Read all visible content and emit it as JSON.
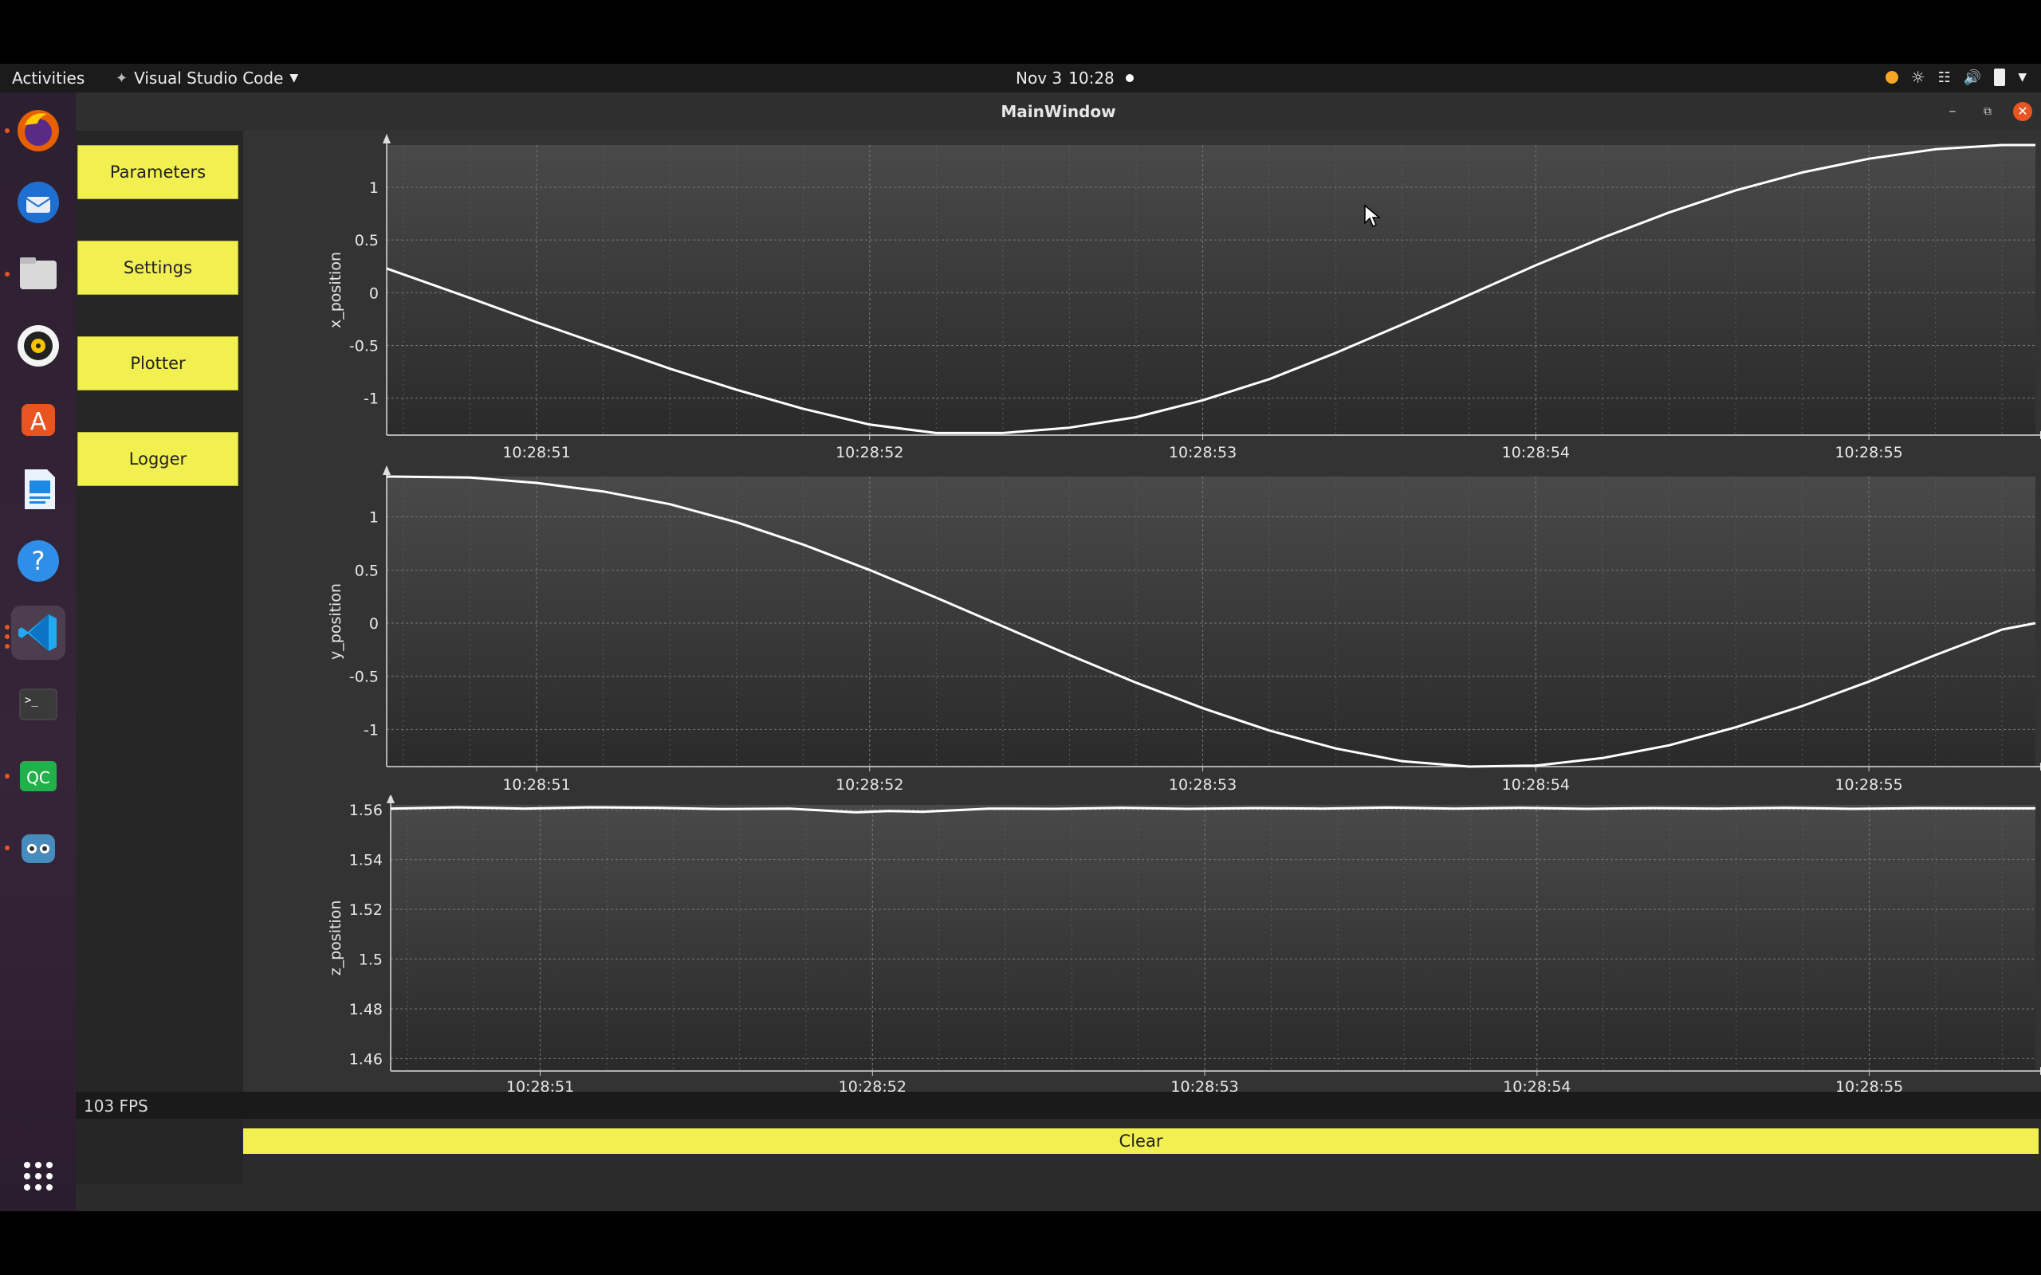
{
  "topbar": {
    "activities": "Activities",
    "app_name": "Visual Studio Code",
    "date": "Nov 3",
    "time": "10:28"
  },
  "dock": {
    "items": [
      "firefox-icon",
      "thunderbird-icon",
      "files-icon",
      "rhythmbox-icon",
      "software-icon",
      "writer-icon",
      "help-icon",
      "vscode-icon",
      "terminal-icon",
      "qc-icon",
      "godot-icon"
    ],
    "qc_label": "QC",
    "terminal_label": ">_",
    "help_label": "?"
  },
  "window": {
    "title": "MainWindow",
    "nav": [
      "Parameters",
      "Settings",
      "Plotter",
      "Logger"
    ],
    "clear_label": "Clear",
    "status": "103 FPS"
  },
  "colors": {
    "accent": "#f2ef51",
    "close": "#e95420"
  },
  "chart_data": [
    {
      "type": "line",
      "ylabel": "x_position",
      "x_ticks": [
        "10:28:51",
        "10:28:52",
        "10:28:53",
        "10:28:54",
        "10:28:55"
      ],
      "y_ticks": [
        1,
        0.5,
        0,
        -0.5,
        -1
      ],
      "xlim": [
        50.55,
        55.5
      ],
      "ylim": [
        -1.35,
        1.4
      ],
      "x": [
        50.55,
        50.8,
        51.0,
        51.2,
        51.4,
        51.6,
        51.8,
        52.0,
        52.2,
        52.4,
        52.6,
        52.8,
        53.0,
        53.2,
        53.4,
        53.6,
        53.8,
        54.0,
        54.2,
        54.4,
        54.6,
        54.8,
        55.0,
        55.2,
        55.4,
        55.5
      ],
      "values": [
        0.23,
        -0.05,
        -0.28,
        -0.5,
        -0.72,
        -0.92,
        -1.1,
        -1.25,
        -1.33,
        -1.33,
        -1.28,
        -1.18,
        -1.02,
        -0.82,
        -0.57,
        -0.3,
        -0.02,
        0.26,
        0.52,
        0.76,
        0.97,
        1.14,
        1.27,
        1.36,
        1.4,
        1.4
      ],
      "grid": true
    },
    {
      "type": "line",
      "ylabel": "y_position",
      "x_ticks": [
        "10:28:51",
        "10:28:52",
        "10:28:53",
        "10:28:54",
        "10:28:55"
      ],
      "y_ticks": [
        1,
        0.5,
        0,
        -0.5,
        -1
      ],
      "xlim": [
        50.55,
        55.5
      ],
      "ylim": [
        -1.35,
        1.38
      ],
      "x": [
        50.55,
        50.8,
        51.0,
        51.2,
        51.4,
        51.6,
        51.8,
        52.0,
        52.2,
        52.4,
        52.6,
        52.8,
        53.0,
        53.2,
        53.4,
        53.6,
        53.8,
        54.0,
        54.2,
        54.4,
        54.6,
        54.8,
        55.0,
        55.2,
        55.4,
        55.5
      ],
      "values": [
        1.38,
        1.37,
        1.32,
        1.24,
        1.12,
        0.95,
        0.74,
        0.5,
        0.24,
        -0.03,
        -0.3,
        -0.56,
        -0.8,
        -1.01,
        -1.18,
        -1.3,
        -1.35,
        -1.34,
        -1.27,
        -1.15,
        -0.98,
        -0.78,
        -0.55,
        -0.3,
        -0.06,
        0.0
      ],
      "grid": true
    },
    {
      "type": "line",
      "ylabel": "z_position",
      "x_ticks": [
        "10:28:51",
        "10:28:52",
        "10:28:53",
        "10:28:54",
        "10:28:55"
      ],
      "y_ticks": [
        1.56,
        1.54,
        1.52,
        1.5,
        1.48,
        1.46
      ],
      "xlim": [
        50.55,
        55.5
      ],
      "ylim": [
        1.455,
        1.562
      ],
      "x": [
        50.55,
        50.75,
        50.95,
        51.15,
        51.35,
        51.55,
        51.75,
        51.95,
        52.05,
        52.15,
        52.35,
        52.55,
        52.75,
        52.95,
        53.15,
        53.35,
        53.55,
        53.75,
        53.95,
        54.15,
        54.35,
        54.55,
        54.75,
        54.95,
        55.15,
        55.35,
        55.5
      ],
      "values": [
        1.5605,
        1.561,
        1.5605,
        1.561,
        1.5608,
        1.5603,
        1.5605,
        1.559,
        1.5595,
        1.5592,
        1.5605,
        1.5604,
        1.5608,
        1.5604,
        1.5607,
        1.5605,
        1.5609,
        1.5605,
        1.5608,
        1.5604,
        1.5607,
        1.5605,
        1.5608,
        1.5604,
        1.5607,
        1.5606,
        1.5606
      ],
      "grid": true
    }
  ]
}
